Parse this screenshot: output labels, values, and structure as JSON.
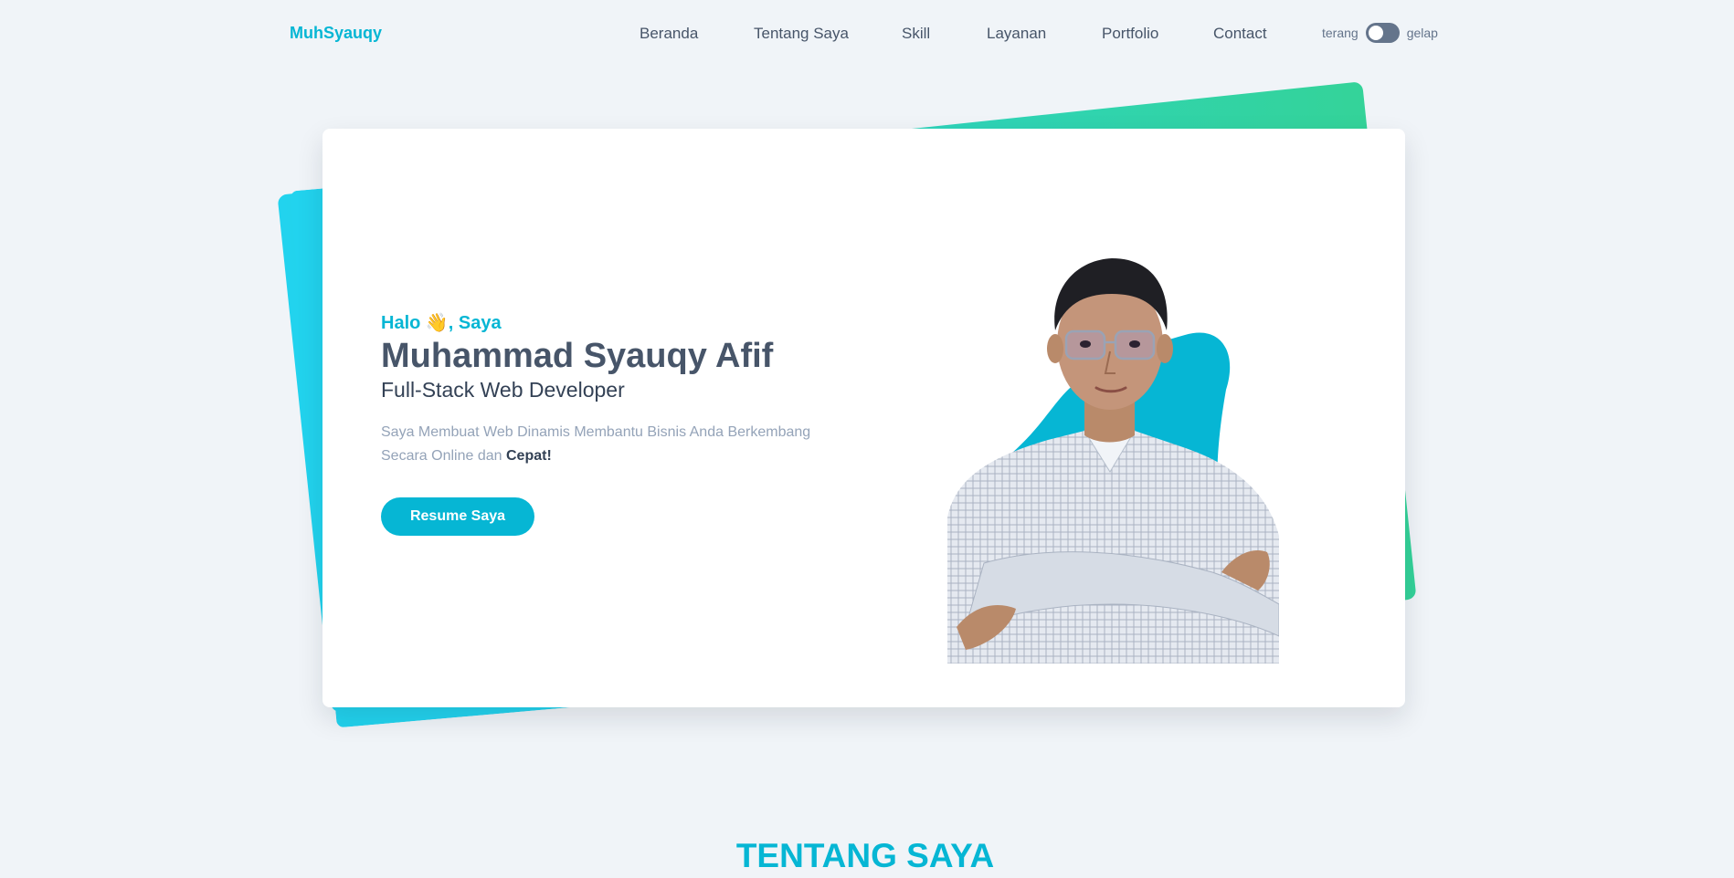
{
  "nav": {
    "brand": "MuhSyauqy",
    "links": [
      "Beranda",
      "Tentang Saya",
      "Skill",
      "Layanan",
      "Portfolio",
      "Contact"
    ],
    "theme_light_label": "terang",
    "theme_dark_label": "gelap"
  },
  "hero": {
    "greeting": "Halo 👋, Saya",
    "name": "Muhammad Syauqy Afif",
    "role": "Full-Stack Web Developer",
    "description": "Saya Membuat Web Dinamis Membantu Bisnis Anda Berkembang Secara Online dan",
    "description_emphasis": "Cepat!",
    "resume_button": "Resume Saya"
  },
  "next_section_title": "TENTANG SAYA",
  "colors": {
    "accent": "#06b6d4",
    "background": "#f0f4f8",
    "text_dark": "#475569",
    "text_muted": "#94a3b8",
    "shape_cyan": "#22d3ee",
    "shape_green": "#34d399"
  }
}
